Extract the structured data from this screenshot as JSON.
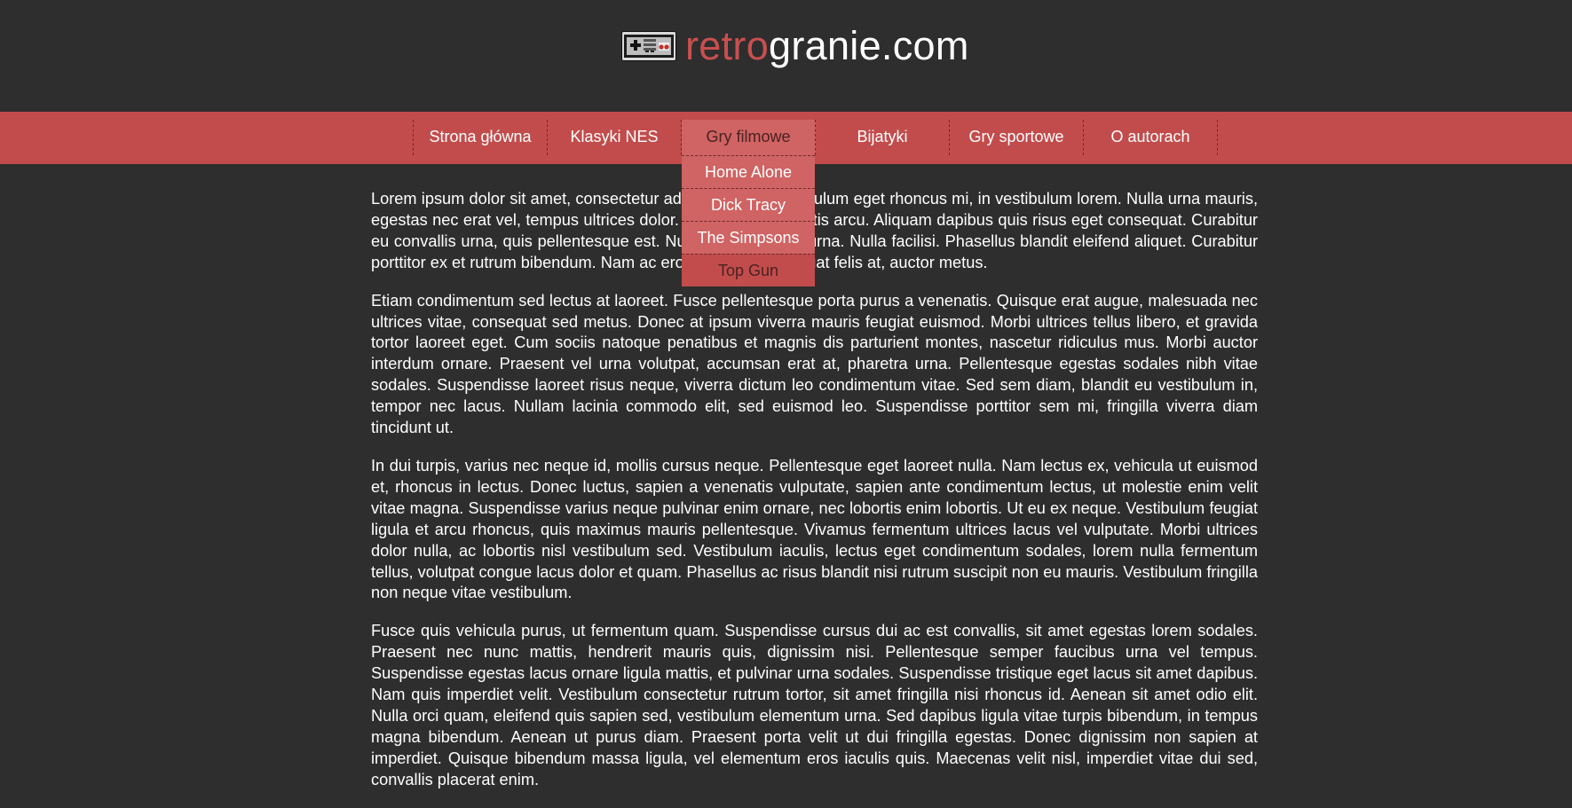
{
  "header": {
    "brand_red": "retro",
    "brand_white": "granie.com",
    "logo_icon": "nes-controller-icon",
    "accent_color": "#c94f4f"
  },
  "nav": {
    "items": [
      {
        "label": "Strona główna"
      },
      {
        "label": "Klasyki NES"
      },
      {
        "label": "Gry filmowe"
      },
      {
        "label": "Bijatyki"
      },
      {
        "label": "Gry sportowe"
      },
      {
        "label": "O autorach"
      }
    ],
    "active_index": 2,
    "dropdown": [
      {
        "label": "Home Alone"
      },
      {
        "label": "Dick Tracy"
      },
      {
        "label": "The Simpsons"
      },
      {
        "label": "Top Gun"
      }
    ],
    "colors": {
      "bar": "#c24c4c",
      "active": "#d06363"
    }
  },
  "content": {
    "paragraphs": [
      "Lorem ipsum dolor sit amet, consectetur adipiscing elit. Vestibulum eget rhoncus mi, in vestibulum lorem. Nulla urna mauris, egestas nec erat vel, tempus ultrices dolor. Maecenas eu mattis arcu. Aliquam dapibus quis risus eget consequat. Curabitur eu convallis urna, quis pellentesque est. Nunc eget posuere urna. Nulla facilisi. Phasellus blandit eleifend aliquet. Curabitur porttitor ex et rutrum bibendum. Nam ac eros laoreet, consequat felis at, auctor metus.",
      "Etiam condimentum sed lectus at laoreet. Fusce pellentesque porta purus a venenatis. Quisque erat augue, malesuada nec ultrices vitae, consequat sed metus. Donec at ipsum viverra mauris feugiat euismod. Morbi ultrices tellus libero, et gravida tortor laoreet eget. Cum sociis natoque penatibus et magnis dis parturient montes, nascetur ridiculus mus. Morbi auctor interdum ornare. Praesent vel urna volutpat, accumsan erat at, pharetra urna. Pellentesque egestas sodales nibh vitae sodales. Suspendisse laoreet risus neque, viverra dictum leo condimentum vitae. Sed sem diam, blandit eu vestibulum in, tempor nec lacus. Nullam lacinia commodo elit, sed euismod leo. Suspendisse porttitor sem mi, fringilla viverra diam tincidunt ut.",
      "In dui turpis, varius nec neque id, mollis cursus neque. Pellentesque eget laoreet nulla. Nam lectus ex, vehicula ut euismod et, rhoncus in lectus. Donec luctus, sapien a venenatis vulputate, sapien ante condimentum lectus, ut molestie enim velit vitae magna. Suspendisse varius neque pulvinar enim ornare, nec lobortis enim lobortis. Ut eu ex neque. Vestibulum feugiat ligula et arcu rhoncus, quis maximus mauris pellentesque. Vivamus fermentum ultrices lacus vel vulputate. Morbi ultrices dolor nulla, ac lobortis nisl vestibulum sed. Vestibulum iaculis, lectus eget condimentum sodales, lorem nulla fermentum tellus, volutpat congue lacus dolor et quam. Phasellus ac risus blandit nisi rutrum suscipit non eu mauris. Vestibulum fringilla non neque vitae vestibulum.",
      "Fusce quis vehicula purus, ut fermentum quam. Suspendisse cursus dui ac est convallis, sit amet egestas lorem sodales. Praesent nec nunc mattis, hendrerit mauris quis, dignissim nisi. Pellentesque semper faucibus urna vel tempus. Suspendisse egestas lacus ornare ligula mattis, et pulvinar urna sodales. Suspendisse tristique eget lacus sit amet dapibus. Nam quis imperdiet velit. Vestibulum consectetur rutrum tortor, sit amet fringilla nisi rhoncus id. Aenean sit amet odio elit. Nulla orci quam, eleifend quis sapien sed, vestibulum elementum urna. Sed dapibus ligula vitae turpis bibendum, in tempus magna bibendum. Aenean ut purus diam. Praesent porta velit ut dui fringilla egestas. Donec dignissim non sapien at imperdiet. Quisque bibendum massa ligula, vel elementum eros iaculis quis. Maecenas velit nisl, imperdiet vitae dui sed, convallis placerat enim."
    ]
  }
}
